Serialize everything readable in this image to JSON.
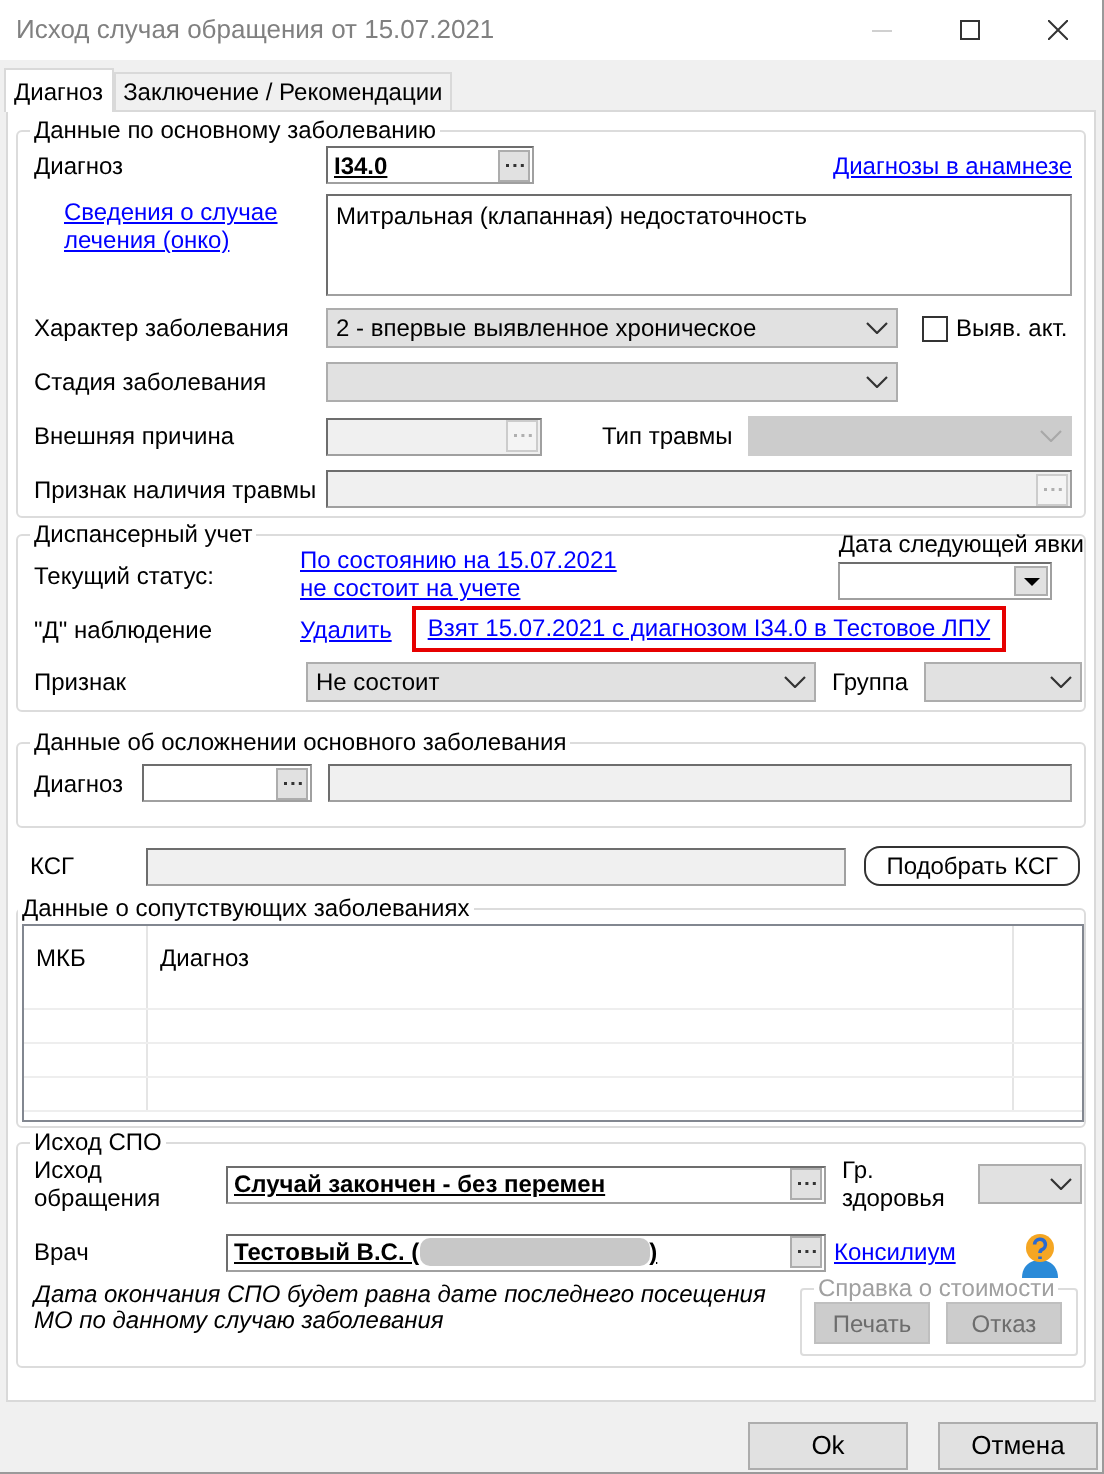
{
  "window": {
    "title": "Исход случая обращения от 15.07.2021"
  },
  "tabs": [
    {
      "label": "Диагноз",
      "selected": true
    },
    {
      "label": "Заключение / Рекомендации",
      "selected": false
    }
  ],
  "main_disease": {
    "legend": "Данные по основному заболеванию",
    "diagnosis_label": "Диагноз",
    "diagnosis_code": "I34.0",
    "history_link": "Диагнозы в анамнезе",
    "onko_link": "Сведения о случае лечения (онко)",
    "diagnosis_text": "Митральная (клапанная) недостаточность",
    "character": {
      "label": "Характер заболевания",
      "value": "2 - впервые выявленное хроническое",
      "disabled": false
    },
    "detected_active": {
      "label": "Выяв. акт.",
      "checked": false
    },
    "stage": {
      "label": "Стадия заболевания",
      "disabled": false
    },
    "external_cause": {
      "label": "Внешняя причина",
      "disabled": true
    },
    "injury_type": {
      "label": "Тип травмы",
      "disabled": true
    },
    "injury_sign": {
      "label": "Признак наличия травмы",
      "disabled": true
    }
  },
  "dispensary": {
    "legend": "Диспансерный учет",
    "status_label": "Текущий статус:",
    "status_links": [
      "По состоянию на 15.07.2021",
      "не состоит на учете"
    ],
    "next_visit_label": "Дата следующей явки",
    "observation_label": "\"Д\" наблюдение",
    "delete_link": "Удалить",
    "taken_link": "Взят 15.07.2021 с диагнозом I34.0 в Тестовое ЛПУ",
    "taken_highlighted": true,
    "sign": {
      "label": "Признак",
      "value": "Не состоит",
      "disabled": false
    },
    "group": {
      "label": "Группа",
      "disabled": false
    }
  },
  "complication": {
    "legend": "Данные об осложнении основного заболевания",
    "diagnosis_label": "Диагноз"
  },
  "ksg": {
    "label": "КСГ",
    "button": "Подобрать КСГ"
  },
  "comorbid": {
    "legend": "Данные о сопутствующих заболеваниях",
    "columns": [
      "МКБ",
      "Диагноз"
    ]
  },
  "outcome": {
    "legend": "Исход СПО",
    "outcome_label": "Исход обращения",
    "outcome_value": "Случай закончен - без перемен",
    "health_group_label": "Гр. здоровья",
    "doctor_label": "Врач",
    "doctor_value": "Тестовый В.С. (",
    "doctor_value_end": ")",
    "consilium_link": "Консилиум",
    "note_lines": [
      "Дата окончания СПО будет равна дате последнего посещения",
      "МО по данному случаю заболевания"
    ],
    "cost_certificate": {
      "legend": "Справка о стоимости",
      "disabled": true,
      "buttons": [
        {
          "label": "Печать",
          "disabled": true
        },
        {
          "label": "Отказ",
          "disabled": true
        }
      ]
    }
  },
  "buttons": [
    {
      "label": "Ok"
    },
    {
      "label": "Отмена"
    }
  ]
}
